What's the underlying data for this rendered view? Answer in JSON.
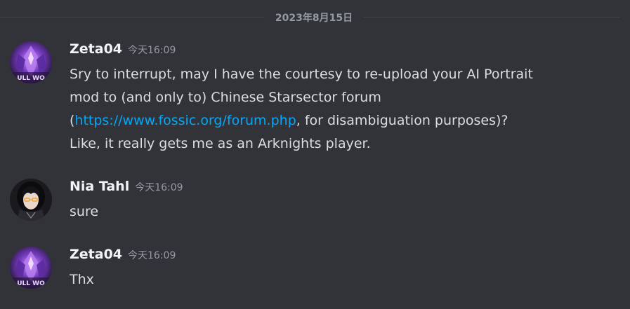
{
  "divider": {
    "date": "2023年8月15日"
  },
  "messages": [
    {
      "username": "Zeta04",
      "timestamp": "今天16:09",
      "avatar": "purple-knight-avatar",
      "lines": {
        "l1": "Sry to interrupt, may I have the courtesy to re-upload your AI Portrait",
        "l2": "mod to (and only to) Chinese Starsector forum",
        "l3_pre": "(",
        "l3_link": "https://www.fossic.org/forum.php",
        "l3_post": ", for disambiguation purposes)?",
        "l4": "Like, it really gets me as an Arknights player."
      }
    },
    {
      "username": "Nia Tahl",
      "timestamp": "今天16:09",
      "avatar": "dark-haired-girl-avatar",
      "text": "sure"
    },
    {
      "username": "Zeta04",
      "timestamp": "今天16:09",
      "avatar": "purple-knight-avatar",
      "text": "Thx"
    }
  ],
  "colors": {
    "background": "#313338",
    "username": "#f2f3f5",
    "text": "#dbdee1",
    "muted": "#949ba4",
    "link": "#00a8fc"
  }
}
